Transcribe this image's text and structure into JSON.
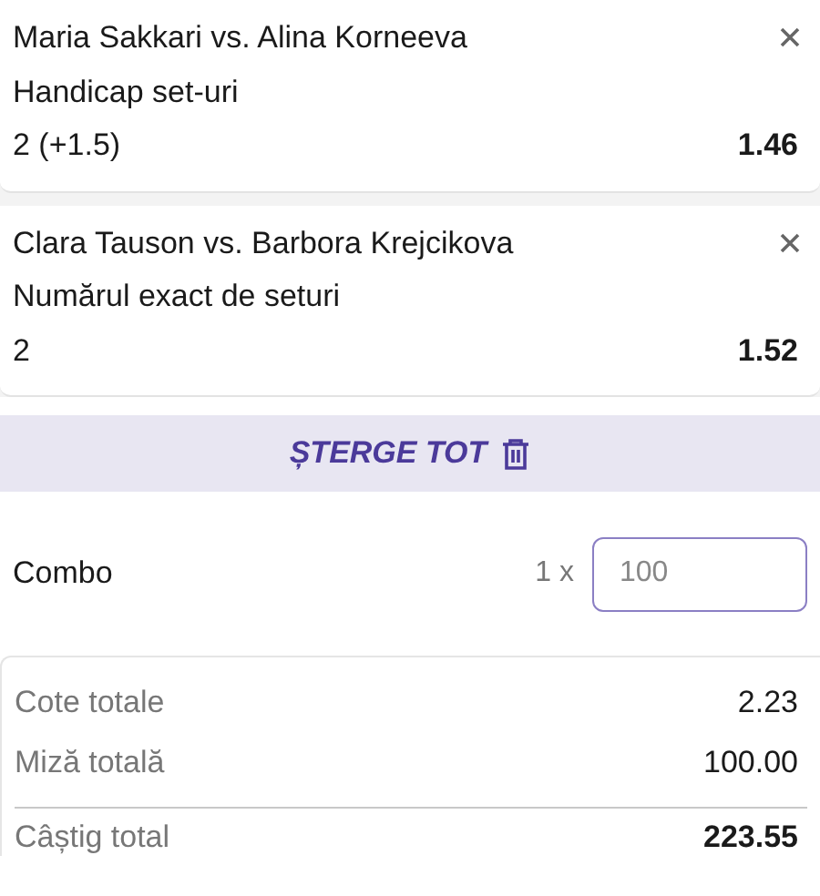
{
  "bets": [
    {
      "match": "Maria Sakkari vs. Alina Korneeva",
      "market": "Handicap set-uri",
      "selection": "2 (+1.5)",
      "odds": "1.46"
    },
    {
      "match": "Clara Tauson vs. Barbora Krejcikova",
      "market": "Numărul exact de seturi",
      "selection": "2",
      "odds": "1.52"
    }
  ],
  "clear_all": {
    "label": "ȘTERGE TOT"
  },
  "combo": {
    "label": "Combo",
    "multiplier": "1 x",
    "stake_placeholder": "100"
  },
  "summary": [
    {
      "label": "Cote totale",
      "value": "2.23",
      "kind": "plain"
    },
    {
      "label": "Miză totală",
      "value": "100.00",
      "kind": "plain"
    },
    {
      "label": "Câștig total",
      "value": "223.55",
      "kind": "total"
    }
  ]
}
